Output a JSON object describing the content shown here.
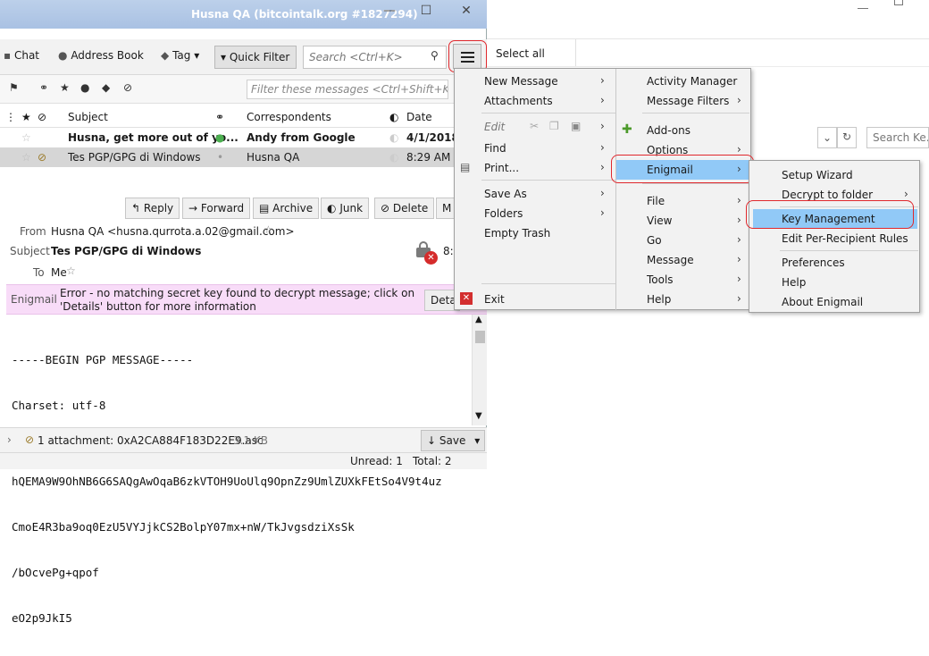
{
  "window": {
    "title": "Husna QA (bitcointalk.org #1827294)",
    "minimize": "—",
    "maximize": "☐",
    "close": "✕"
  },
  "toolbar": {
    "chat": "Chat",
    "address_book": "Address Book",
    "tag": "Tag",
    "quick_filter": "Quick Filter",
    "search_placeholder": "Search <Ctrl+K>"
  },
  "filter": {
    "placeholder": "Filter these messages <Ctrl+Shift+K>"
  },
  "columns": {
    "subject": "Subject",
    "correspondents": "Correspondents",
    "date": "Date"
  },
  "messages": [
    {
      "subject": "Husna, get more out of yo...",
      "correspondent": "Andy from Google",
      "date": "4/1/2018",
      "bold": true
    },
    {
      "subject": "Tes PGP/GPG di Windows",
      "correspondent": "Husna QA",
      "date": "8:29 AM",
      "bold": false
    }
  ],
  "actions": {
    "reply": "Reply",
    "forward": "Forward",
    "archive": "Archive",
    "junk": "Junk",
    "delete": "Delete",
    "more": "M"
  },
  "header": {
    "from_label": "From",
    "from_value": "Husna QA <husna.qurrota.a.02@gmail.com>",
    "subject_label": "Subject",
    "subject_value": "Tes PGP/GPG di Windows",
    "to_label": "To",
    "to_value": "Me",
    "time_partial": "8:"
  },
  "enigmail_bar": {
    "label": "Enigmail",
    "message": "Error - no matching secret key found to decrypt message; click on 'Details' button for more information",
    "details": "Deta"
  },
  "body_lines": [
    "-----BEGIN PGP MESSAGE-----",
    "Charset: utf-8",
    "",
    "hQEMA9W9OhNB6G6SAQgAwOqaB6zkVTOH9UoUlq9OpnZz9UmlZUXkFEtSo4V9t4uz",
    "CmoE4R3ba9oq0EzU5VYJjkCS2BolpY07mx+nW/TkJvgsdziXsSk",
    "/bOcvePg+qpof",
    "eO2p9JkI5"
  ],
  "attachment": {
    "text": "1 attachment: 0xA2CA884F183D22E9.asc",
    "size": "3.1 KB",
    "save": "Save"
  },
  "status": {
    "unread": "Unread: 1",
    "total": "Total: 2"
  },
  "background_window": {
    "select_all": "Select all",
    "search_placeholder": "Search Ke..."
  },
  "main_menu": {
    "left": [
      "New Message",
      "Attachments",
      "Edit",
      "Find",
      "Print...",
      "Save As",
      "Folders",
      "Empty Trash",
      "Exit"
    ],
    "right": [
      "Activity Manager",
      "Message Filters",
      "Add-ons",
      "Options",
      "Enigmail",
      "File",
      "View",
      "Go",
      "Message",
      "Tools",
      "Help"
    ]
  },
  "enigmail_menu": [
    "Setup Wizard",
    "Decrypt to folder",
    "Key Management",
    "Edit Per-Recipient Rules",
    "Preferences",
    "Help",
    "About Enigmail"
  ],
  "colors": {
    "highlight": "#91c9f7",
    "annotation_ring": "#e0282d",
    "enigmail_bar_bg": "#f8dcf8",
    "titlebar": "#a9c1e3"
  }
}
